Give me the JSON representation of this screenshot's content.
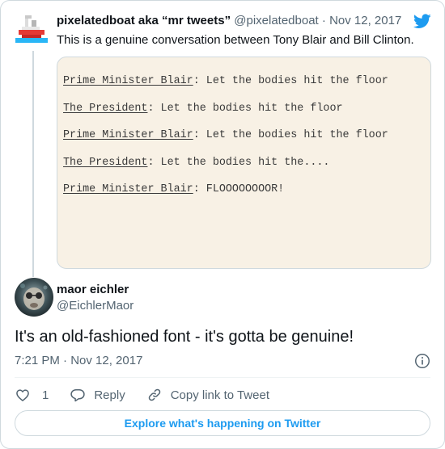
{
  "parent_tweet": {
    "author_name": "pixelatedboat aka “mr tweets”",
    "author_handle": "@pixelatedboat",
    "separator": "·",
    "date": "Nov 12, 2017",
    "text": "This is a genuine conversation between Tony Blair and Bill Clinton.",
    "avatar_icon": "pixel-boat-avatar",
    "script_lines": [
      {
        "speaker": "Prime Minister Blair",
        "line": ": Let the bodies hit the floor"
      },
      {
        "speaker": "The President",
        "line": ": Let the bodies hit the floor"
      },
      {
        "speaker": "Prime Minister Blair",
        "line": ": Let the bodies hit the floor"
      },
      {
        "speaker": "The President",
        "line": ": Let the bodies hit the...."
      },
      {
        "speaker": "Prime Minister Blair",
        "line": ": FLOOOOOOOOR!"
      }
    ]
  },
  "tweet": {
    "author_name": "maor eichler",
    "author_handle": "@EichlerMaor",
    "text": "It's an old-fashioned font - it's gotta be genuine!",
    "timestamp": "7:21 PM · Nov 12, 2017"
  },
  "actions": {
    "like_count": "1",
    "reply_label": "Reply",
    "copy_link_label": "Copy link to Tweet"
  },
  "explore_label": "Explore what's happening on Twitter",
  "colors": {
    "accent": "#1d9bf0",
    "muted": "#536471",
    "media_bg": "#f8f1e5"
  }
}
